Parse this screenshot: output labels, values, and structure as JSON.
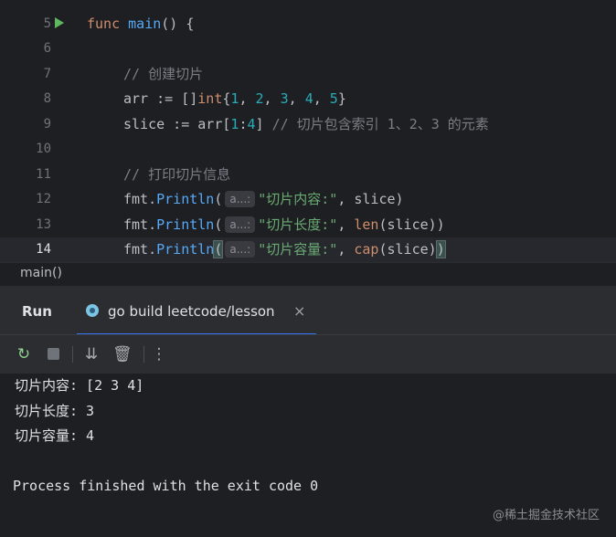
{
  "editor": {
    "line_numbers": [
      "5",
      "6",
      "7",
      "8",
      "9",
      "10",
      "11",
      "12",
      "13",
      "14"
    ],
    "lines": {
      "l5": {
        "kw": "func",
        "name": "main",
        "rest": "() {"
      },
      "l7": {
        "comment": "// 创建切片"
      },
      "l8": {
        "a": "arr := []",
        "type": "int",
        "b": "{",
        "n1": "1",
        ",1": ", ",
        "n2": "2",
        ",2": ", ",
        "n3": "3",
        ",3": ", ",
        "n4": "4",
        ",4": ", ",
        "n5": "5",
        "c": "}"
      },
      "l9": {
        "a": "slice := arr[",
        "n1": "1",
        "b": ":",
        "n2": "4",
        "c": "] ",
        "comment": "// 切片包含索引 1、2、3 的元素"
      },
      "l11": {
        "comment": "// 打印切片信息"
      },
      "l12": {
        "a": "fmt.",
        "fn": "Println",
        "b": "(",
        "hint": "a...:",
        "str": "\"切片内容:\"",
        "c": ", slice)"
      },
      "l13": {
        "a": "fmt.",
        "fn": "Println",
        "b": "(",
        "hint": "a...:",
        "str": "\"切片长度:\"",
        "c": ", ",
        "builtin": "len",
        "d": "(slice))"
      },
      "l14": {
        "a": "fmt.",
        "fn": "Println",
        "b": "(",
        "hint": "a...:",
        "str": "\"切片容量:\"",
        "c": ", ",
        "builtin": "cap",
        "d": "(slice)",
        "e": ")"
      }
    }
  },
  "breadcrumb": "main()",
  "tool_window": {
    "title": "Run",
    "tab_label": "go build leetcode/lesson",
    "tab_close": "×"
  },
  "toolbar": {
    "rerun_icon": "rerun-icon",
    "stop_icon": "stop-icon",
    "scroll_icon": "scroll-to-end-icon",
    "trash_icon": "trash-icon",
    "more_icon": "more-icon",
    "trash_glyph": "🗑",
    "more_glyph": "⋮",
    "rerun_glyph": "↻",
    "scroll_glyph": "⇊"
  },
  "console": {
    "lines": [
      "切片内容: [2 3 4]",
      "切片长度: 3",
      "切片容量: 4",
      "",
      "Process finished with the exit code 0"
    ]
  },
  "watermark": "@稀土掘金技术社区",
  "colors": {
    "background": "#1e1f22",
    "panel": "#2b2d30",
    "keyword": "#cf8e6d",
    "function": "#57aaf7",
    "number": "#2aacb8",
    "string": "#6aab73",
    "comment": "#7a7e85",
    "tab_underline": "#3574f0"
  }
}
